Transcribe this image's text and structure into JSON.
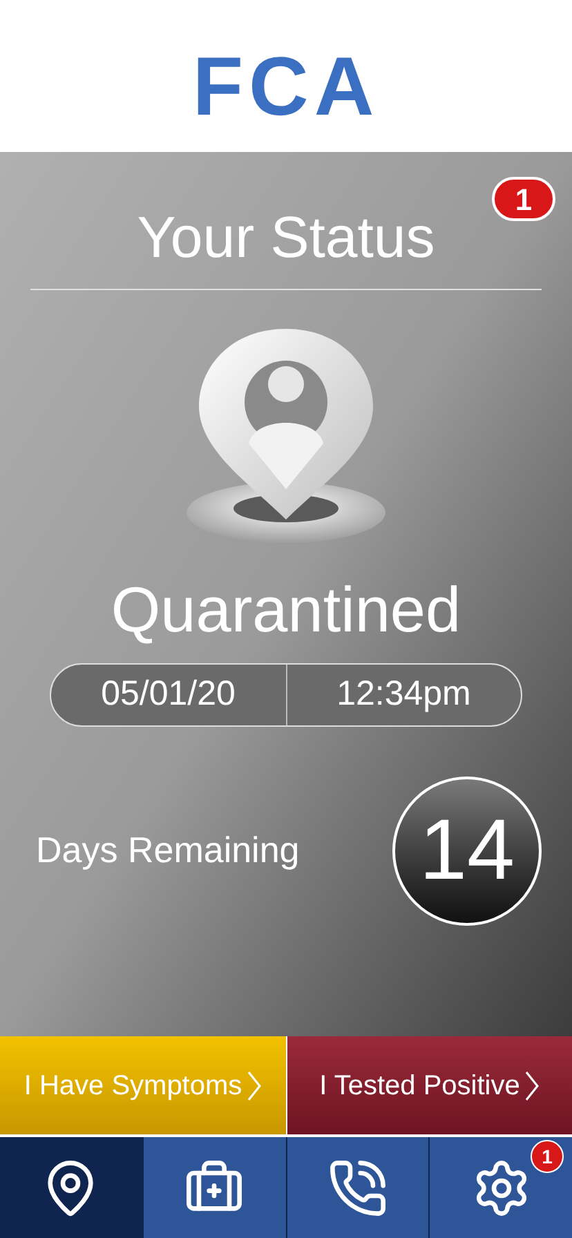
{
  "logo": {
    "text": "FCA"
  },
  "status": {
    "title": "Your Status",
    "notification_count": "1",
    "state": "Quarantined",
    "date": "05/01/20",
    "time": "12:34pm",
    "days_label": "Days Remaining",
    "days": "14"
  },
  "actions": [
    {
      "label": "I Have Symptoms",
      "kind": "symptoms"
    },
    {
      "label": "I Tested Positive",
      "kind": "positive"
    }
  ],
  "nav": [
    {
      "kind": "location",
      "selected": true
    },
    {
      "kind": "medical",
      "selected": false
    },
    {
      "kind": "phone",
      "selected": false
    },
    {
      "kind": "settings",
      "selected": false,
      "badge": "1"
    }
  ]
}
